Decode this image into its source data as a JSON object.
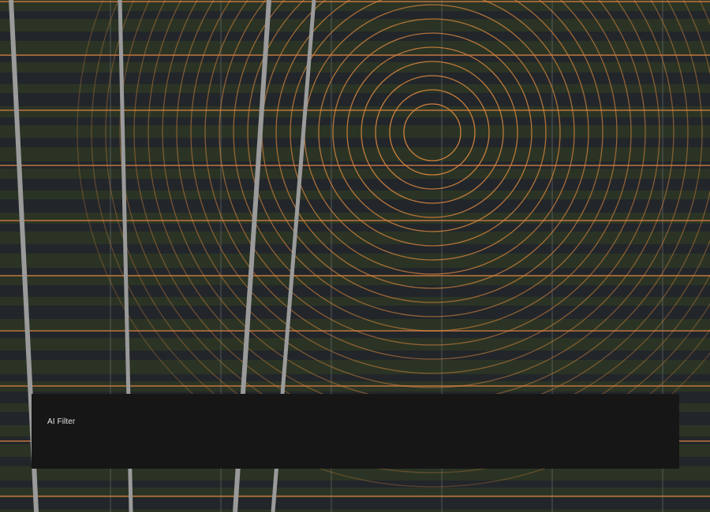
{
  "panel": {
    "label": "AI Filter"
  },
  "background": {
    "palette": {
      "band_colors": [
        "#2b3424",
        "#32242a",
        "#3b2a22",
        "#22262a",
        "#26301e",
        "#3a2227",
        "#2f2a22"
      ],
      "grid_line": "#7a7a7a",
      "accent_line": "#c07540",
      "ring": "#d8863f",
      "streak": "#9a9a9a"
    }
  }
}
